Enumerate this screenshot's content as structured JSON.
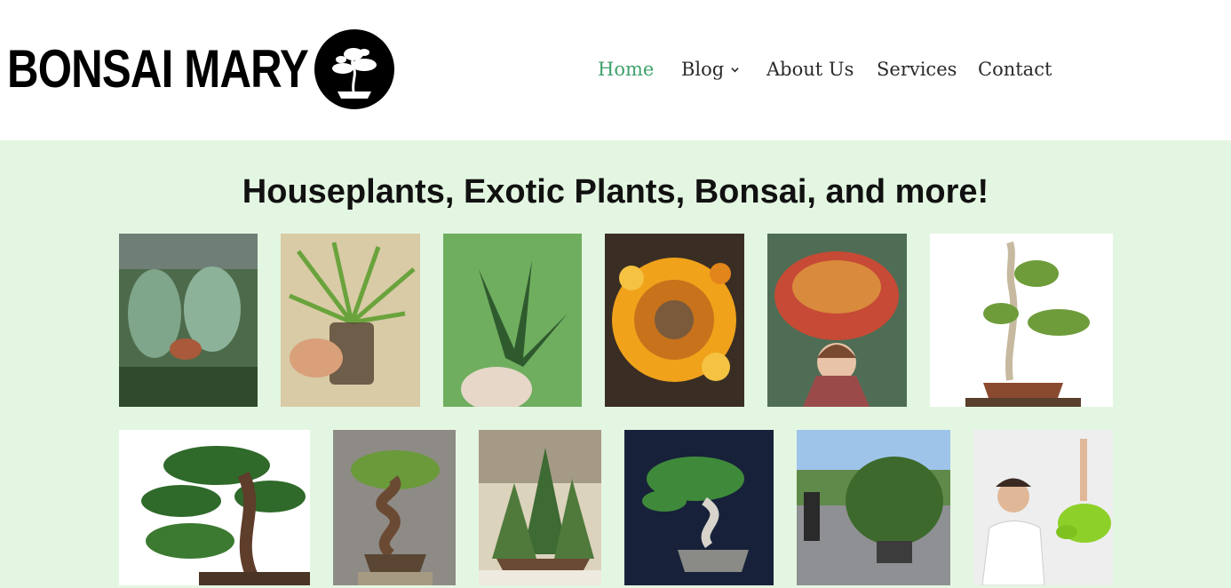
{
  "brand": {
    "name": "BONSAI MARY",
    "logo_icon": "bonsai-tree-icon"
  },
  "nav": {
    "items": [
      {
        "label": "Home",
        "active": true
      },
      {
        "label": "Blog",
        "has_dropdown": true
      },
      {
        "label": "About Us"
      },
      {
        "label": "Services"
      },
      {
        "label": "Contact"
      }
    ],
    "active_color": "#3fa16b",
    "text_color": "#2a2a2a"
  },
  "hero": {
    "headline": "Houseplants, Exotic Plants, Bonsai, and more!"
  },
  "colors": {
    "section_background": "#e3f6e1"
  },
  "gallery": {
    "row1": [
      {
        "subject": "variegated-leaf-houseplant"
      },
      {
        "subject": "spider-plant-in-jar"
      },
      {
        "subject": "aloe-succulent-in-hand"
      },
      {
        "subject": "orange-cactus-flowers"
      },
      {
        "subject": "pitcher-plant-on-head"
      },
      {
        "subject": "juniper-bonsai-white-bg"
      }
    ],
    "row2": [
      {
        "subject": "juniper-bonsai-large"
      },
      {
        "subject": "twisted-trunk-bonsai"
      },
      {
        "subject": "spruce-forest-bonsai"
      },
      {
        "subject": "bonsai-dark-bg"
      },
      {
        "subject": "large-shrub-outdoors"
      },
      {
        "subject": "man-holding-pothos"
      }
    ]
  }
}
